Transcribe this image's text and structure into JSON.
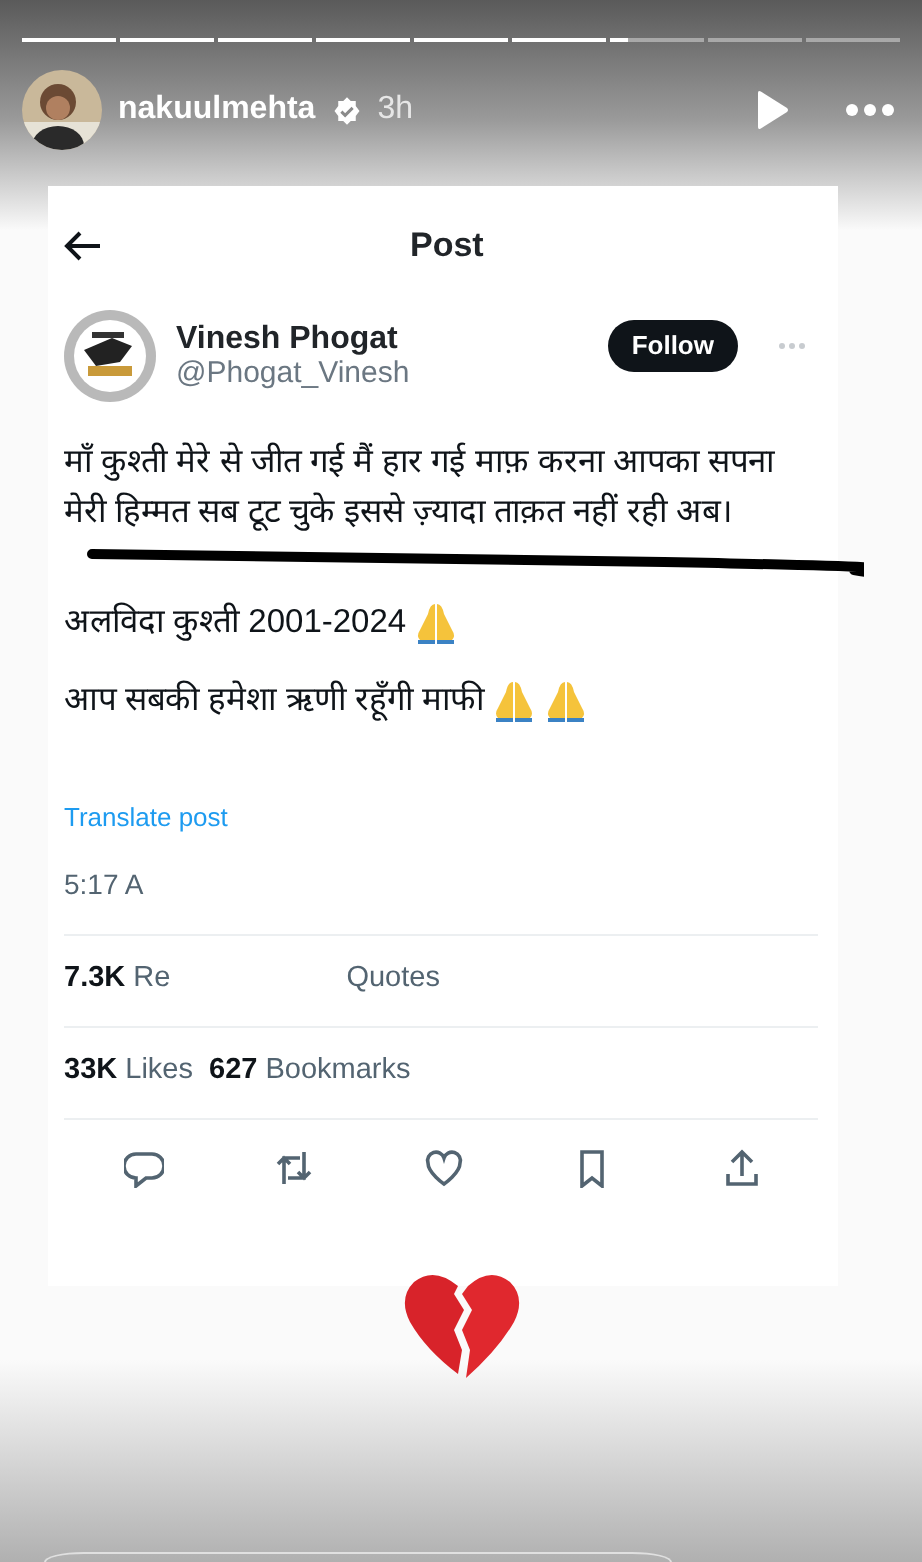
{
  "story": {
    "segments": [
      {
        "kind": "seen"
      },
      {
        "kind": "seen"
      },
      {
        "kind": "seen"
      },
      {
        "kind": "seen"
      },
      {
        "kind": "seen"
      },
      {
        "kind": "seen"
      },
      {
        "kind": "playing",
        "level": 0.2
      },
      {
        "kind": "unseen"
      },
      {
        "kind": "unseen"
      }
    ],
    "user": {
      "username": "nakuulmehta",
      "verified": true,
      "time": "3h"
    }
  },
  "post": {
    "title": "Post",
    "author": {
      "name": "Vinesh Phogat",
      "handle": "@Phogat_Vinesh"
    },
    "follow": "Follow",
    "lines": [
      "माँ कुश्ती मेरे से जीत गई मैं हार गई माफ़ करना आपका सपना",
      "मेरी हिम्मत सब टूट चुके इससे ज़्यादा ताक़त नहीं रही अब।"
    ],
    "paragraphs": [
      {
        "text": "अलविदा कुश्ती 2001-2024",
        "emojis": [
          {
            "kind": "praying-hands"
          }
        ]
      },
      {
        "text": "आप सबकी हमेशा ऋणी रहूँगी माफी",
        "emojis": [
          {
            "kind": "praying-hands"
          },
          {
            "kind": "praying-hands"
          }
        ]
      }
    ],
    "translate": "Translate post",
    "timestamp": "5:17 A",
    "stats": [
      [
        {
          "count": "7.3K",
          "label": "Re"
        },
        {
          "label": "Quotes"
        }
      ],
      [
        {
          "count": "33K",
          "label": "Likes"
        },
        {
          "count": "627",
          "label": "Bookmarks"
        }
      ]
    ]
  }
}
